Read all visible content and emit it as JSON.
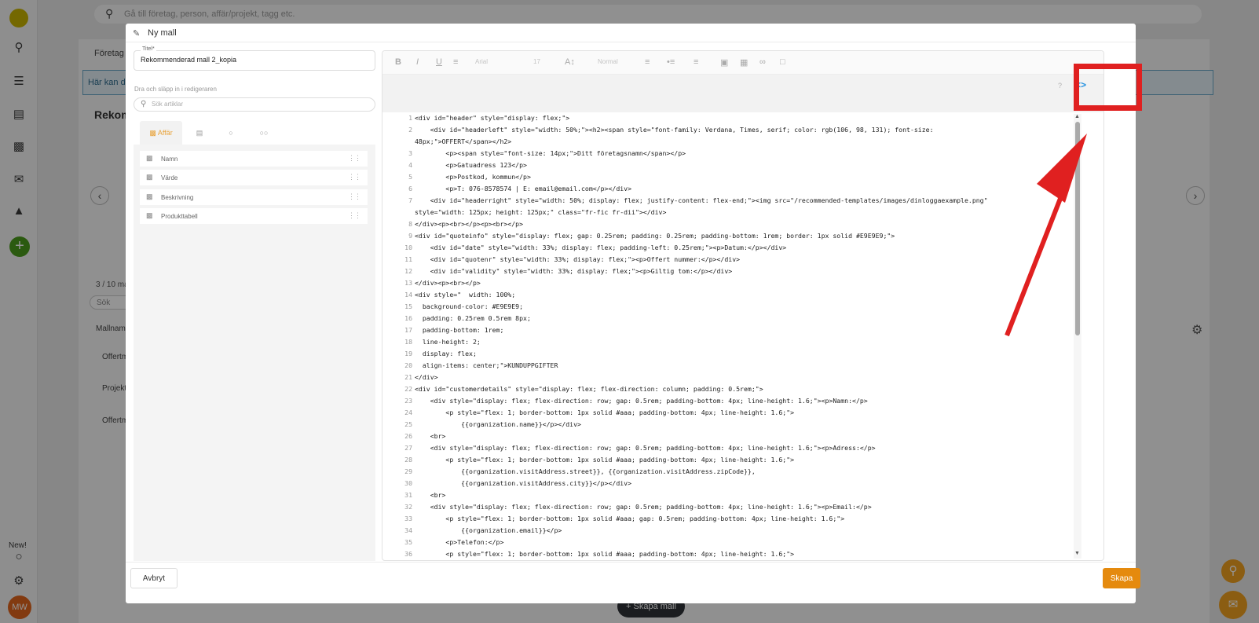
{
  "app": {
    "search_placeholder": "Gå till företag, person, affär/projekt, tagg etc.",
    "nav_new_label": "New!",
    "avatar_initials": "MW",
    "bg_tab": "Företag",
    "bg_info": "Här kan du",
    "bg_heading": "Rekom",
    "bg_count": "3 / 10 ma",
    "bg_search": "Sök",
    "bg_col_header": "Mallnamn",
    "bg_rows": [
      "Offertm",
      "Projekt",
      "Offertm"
    ],
    "bg_create_button": "+ Skapa mall"
  },
  "modal": {
    "title": "Ny mall",
    "title_field_label": "Titel*",
    "title_value": "Rekommenderad mall 2_kopia",
    "drag_hint": "Dra och släpp in i redigeraren",
    "article_search_placeholder": "Sök artiklar",
    "tabs": [
      {
        "label": "Affär",
        "icon": "briefcase-icon",
        "active": true
      },
      {
        "label": "",
        "icon": "table-icon",
        "active": false
      },
      {
        "label": "",
        "icon": "person-icon",
        "active": false
      },
      {
        "label": "",
        "icon": "people-icon",
        "active": false
      }
    ],
    "articles": [
      "Namn",
      "Värde",
      "Beskrivning",
      "Produkttabell"
    ],
    "cancel_label": "Avbryt",
    "create_label": "Skapa"
  },
  "toolbar": {
    "font_family": "Arial",
    "font_size": "17",
    "paragraph_format": "Normal",
    "help_label": "?",
    "codeview_label": "<>"
  },
  "code": [
    {
      "n": "1",
      "t": "<div id=\"header\" style=\"display: flex;\">"
    },
    {
      "n": "2",
      "t": "    <div id=\"headerleft\" style=\"width: 50%;\"><h2><span style=\"font-family: Verdana, Times, serif; color: rgb(106, 98, 131); font-size:"
    },
    {
      "n": "",
      "t": "48px;\">OFFERT</span></h2>"
    },
    {
      "n": "3",
      "t": "        <p><span style=\"font-size: 14px;\">Ditt företagsnamn</span></p>"
    },
    {
      "n": "4",
      "t": "        <p>Gatuadress 123</p>"
    },
    {
      "n": "5",
      "t": "        <p>Postkod, kommun</p>"
    },
    {
      "n": "6",
      "t": "        <p>T: 076-8578574 | E: email@email.com</p></div>"
    },
    {
      "n": "7",
      "t": "    <div id=\"headerright\" style=\"width: 50%; display: flex; justify-content: flex-end;\"><img src=\"/recommended-templates/images/dinloggaexample.png\""
    },
    {
      "n": "",
      "t": "style=\"width: 125px; height: 125px;\" class=\"fr-fic fr-dii\"></div>"
    },
    {
      "n": "8",
      "t": "</div><p><br></p><p><br></p>"
    },
    {
      "n": "9",
      "t": "<div id=\"quoteinfo\" style=\"display: flex; gap: 0.25rem; padding: 0.25rem; padding-bottom: 1rem; border: 1px solid #E9E9E9;\">"
    },
    {
      "n": "10",
      "t": "    <div id=\"date\" style=\"width: 33%; display: flex; padding-left: 0.25rem;\"><p>Datum:</p></div>"
    },
    {
      "n": "11",
      "t": "    <div id=\"quotenr\" style=\"width: 33%; display: flex;\"><p>Offert nummer:</p></div>"
    },
    {
      "n": "12",
      "t": "    <div id=\"validity\" style=\"width: 33%; display: flex;\"><p>Giltig tom:</p></div>"
    },
    {
      "n": "13",
      "t": "</div><p><br></p>"
    },
    {
      "n": "14",
      "t": "<div style=\"  width: 100%;"
    },
    {
      "n": "15",
      "t": "  background-color: #E9E9E9;"
    },
    {
      "n": "16",
      "t": "  padding: 0.25rem 0.5rem 8px;"
    },
    {
      "n": "17",
      "t": "  padding-bottom: 1rem;"
    },
    {
      "n": "18",
      "t": "  line-height: 2;"
    },
    {
      "n": "19",
      "t": "  display: flex;"
    },
    {
      "n": "20",
      "t": "  align-items: center;\">KUNDUPPGIFTER"
    },
    {
      "n": "21",
      "t": "</div>"
    },
    {
      "n": "22",
      "t": "<div id=\"customerdetails\" style=\"display: flex; flex-direction: column; padding: 0.5rem;\">"
    },
    {
      "n": "23",
      "t": "    <div style=\"display: flex; flex-direction: row; gap: 0.5rem; padding-bottom: 4px; line-height: 1.6;\"><p>Namn:</p>"
    },
    {
      "n": "24",
      "t": "        <p style=\"flex: 1; border-bottom: 1px solid #aaa; padding-bottom: 4px; line-height: 1.6;\">"
    },
    {
      "n": "25",
      "t": "            {{organization.name}}</p></div>"
    },
    {
      "n": "26",
      "t": "    <br>"
    },
    {
      "n": "27",
      "t": "    <div style=\"display: flex; flex-direction: row; gap: 0.5rem; padding-bottom: 4px; line-height: 1.6;\"><p>Adress:</p>"
    },
    {
      "n": "28",
      "t": "        <p style=\"flex: 1; border-bottom: 1px solid #aaa; padding-bottom: 4px; line-height: 1.6;\">"
    },
    {
      "n": "29",
      "t": "            {{organization.visitAddress.street}}, {{organization.visitAddress.zipCode}},"
    },
    {
      "n": "30",
      "t": "            {{organization.visitAddress.city}}</p></div>"
    },
    {
      "n": "31",
      "t": "    <br>"
    },
    {
      "n": "32",
      "t": "    <div style=\"display: flex; flex-direction: row; gap: 0.5rem; padding-bottom: 4px; line-height: 1.6;\"><p>Email:</p>"
    },
    {
      "n": "33",
      "t": "        <p style=\"flex: 1; border-bottom: 1px solid #aaa; gap: 0.5rem; padding-bottom: 4px; line-height: 1.6;\">"
    },
    {
      "n": "34",
      "t": "            {{organization.email}}</p>"
    },
    {
      "n": "35",
      "t": "        <p>Telefon:</p>"
    },
    {
      "n": "36",
      "t": "        <p style=\"flex: 1; border-bottom: 1px solid #aaa; padding-bottom: 4px; line-height: 1.6;\">"
    }
  ],
  "colors": {
    "accent": "#e58a0e",
    "code_button": "#1f8fe0",
    "annotation": "#e02020"
  }
}
